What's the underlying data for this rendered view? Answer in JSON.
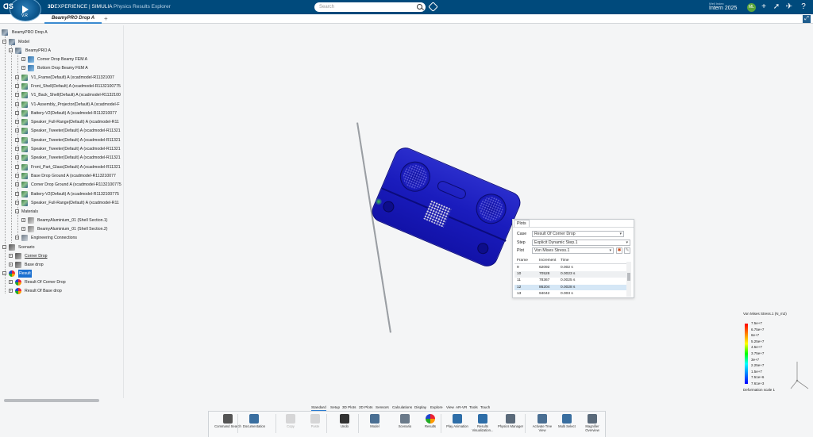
{
  "topbar": {
    "brand_bold": "3D",
    "brand_mid": "EXPERIENCE | SIMULIA",
    "app_name": "Physics Results Explorer",
    "search_placeholder": "Search",
    "user_small": "Well Index",
    "user_name": "Intern 2025",
    "avatar_initials": "ML",
    "version": "V.R"
  },
  "tabs": [
    {
      "label": "BeamyPRO Drop A"
    }
  ],
  "tree": {
    "root": "BeamyPRO Drop A",
    "model": "Model",
    "assembly": "BeamyPRO A",
    "parts": [
      "Corner Drop Beamy FEM A",
      "Bottom Drop Beamy FEM A",
      "V1_Frame(Default) A (xcadmodel-R11321007",
      "Front_Shell(Default) A (xcadmodel-R1132100775",
      "V1_Back_Shell(Default) A (xcadmodel-R1132100",
      "V1-Assembly_Projector(Default) A (xcadmodel-F",
      "Battery-V2(Default) A (xcadmodel-R113210077",
      "Speaker_Full-Range(Default) A (xcadmodel-R11",
      "Speaker_Tweeter(Default) A (xcadmodel-R11321",
      "Speaker_Tweeter(Default) A (xcadmodel-R11321",
      "Speaker_Tweeter(Default) A (xcadmodel-R11321",
      "Speaker_Tweeter(Default) A (xcadmodel-R11321",
      "Front_Part_Glass(Default) A (xcadmodel-R11321",
      "Base Drop Ground A (xcadmodel-R113210077",
      "Corner Drop Ground A (xcadmodel-R1132100775",
      "Battery-V2(Default) A (xcadmodel-R1132100775",
      "Speaker_Full-Range(Default) A (xcadmodel-R11"
    ],
    "materials": "Materials",
    "material_items": [
      "BeamyAluminium_01 (Shell Section.1)",
      "BeamyAluminium_01 (Shell Section.2)"
    ],
    "engineering": "Engineering Connections",
    "scenario": "Scenario",
    "scenario_items": [
      "Corner Drop",
      "Base drop"
    ],
    "result": "Result",
    "result_items": [
      "Result Of Corner Drop",
      "Result Of Base drop"
    ]
  },
  "plots_panel": {
    "tab": "Plots",
    "case_label": "Case",
    "case_value": "Result Of Corner Drop",
    "step_label": "Step",
    "step_value": "Explicit Dynamic Step.1",
    "plot_label": "Plot",
    "plot_value": "Von Mises Stress.1",
    "columns": [
      "Frame",
      "Increment",
      "Time"
    ],
    "rows": [
      {
        "frame": "9",
        "increment": "62092",
        "time": "0.002 s"
      },
      {
        "frame": "10",
        "increment": "70528",
        "time": "0.0023 s"
      },
      {
        "frame": "11",
        "increment": "78367",
        "time": "0.0025 s"
      },
      {
        "frame": "12",
        "increment": "86204",
        "time": "0.0028 s"
      },
      {
        "frame": "13",
        "increment": "94042",
        "time": "0.003 s"
      }
    ],
    "highlighted_frame": "12"
  },
  "legend": {
    "title": "Von Mises Stress.1 (N_m2)",
    "ticks": [
      "7.5e+7",
      "6.75e+7",
      "6e+7",
      "5.25e+7",
      "4.5e+7",
      "3.75e+7",
      "3e+7",
      "2.25e+7",
      "1.5e+7",
      "7.51e+6",
      "7.61e+3"
    ],
    "footer": "Deformation scale 1",
    "colors": [
      "#ff0000",
      "#ff8000",
      "#ffff00",
      "#00ff00",
      "#00ffff",
      "#0080ff",
      "#0000ff"
    ]
  },
  "ribbon": {
    "tabs": [
      "Standard",
      "Setup",
      "3D Plots",
      "2D Plots",
      "Sensors",
      "Calculations",
      "Display",
      "Explore",
      "View",
      "AR-VR",
      "Tools",
      "Touch"
    ],
    "active_tab": "Standard",
    "actions": [
      {
        "label": "Command Search",
        "icon": "command-search-icon"
      },
      {
        "label": "Documentation",
        "icon": "documentation-icon"
      },
      {
        "label": "Copy",
        "icon": "copy-icon"
      },
      {
        "label": "Paste",
        "icon": "paste-icon"
      },
      {
        "label": "Undo",
        "icon": "undo-icon"
      },
      {
        "label": "Model",
        "icon": "model-icon"
      },
      {
        "label": "Scenario",
        "icon": "scenario-icon"
      },
      {
        "label": "Results",
        "icon": "results-icon"
      },
      {
        "label": "Play Animation",
        "icon": "play-animation-icon"
      },
      {
        "label": "Results Visualization...",
        "icon": "results-visualization-icon"
      },
      {
        "label": "Physics Manager",
        "icon": "physics-manager-icon"
      },
      {
        "label": "Activate Tree View",
        "icon": "tree-view-icon"
      },
      {
        "label": "Multi Select",
        "icon": "multi-select-icon"
      },
      {
        "label": "Magnifier Overview",
        "icon": "magnifier-icon"
      }
    ]
  },
  "colors": {
    "topbar": "#004a7c",
    "model_blue": "#1a1cbd",
    "selection": "#1a6fd0"
  }
}
